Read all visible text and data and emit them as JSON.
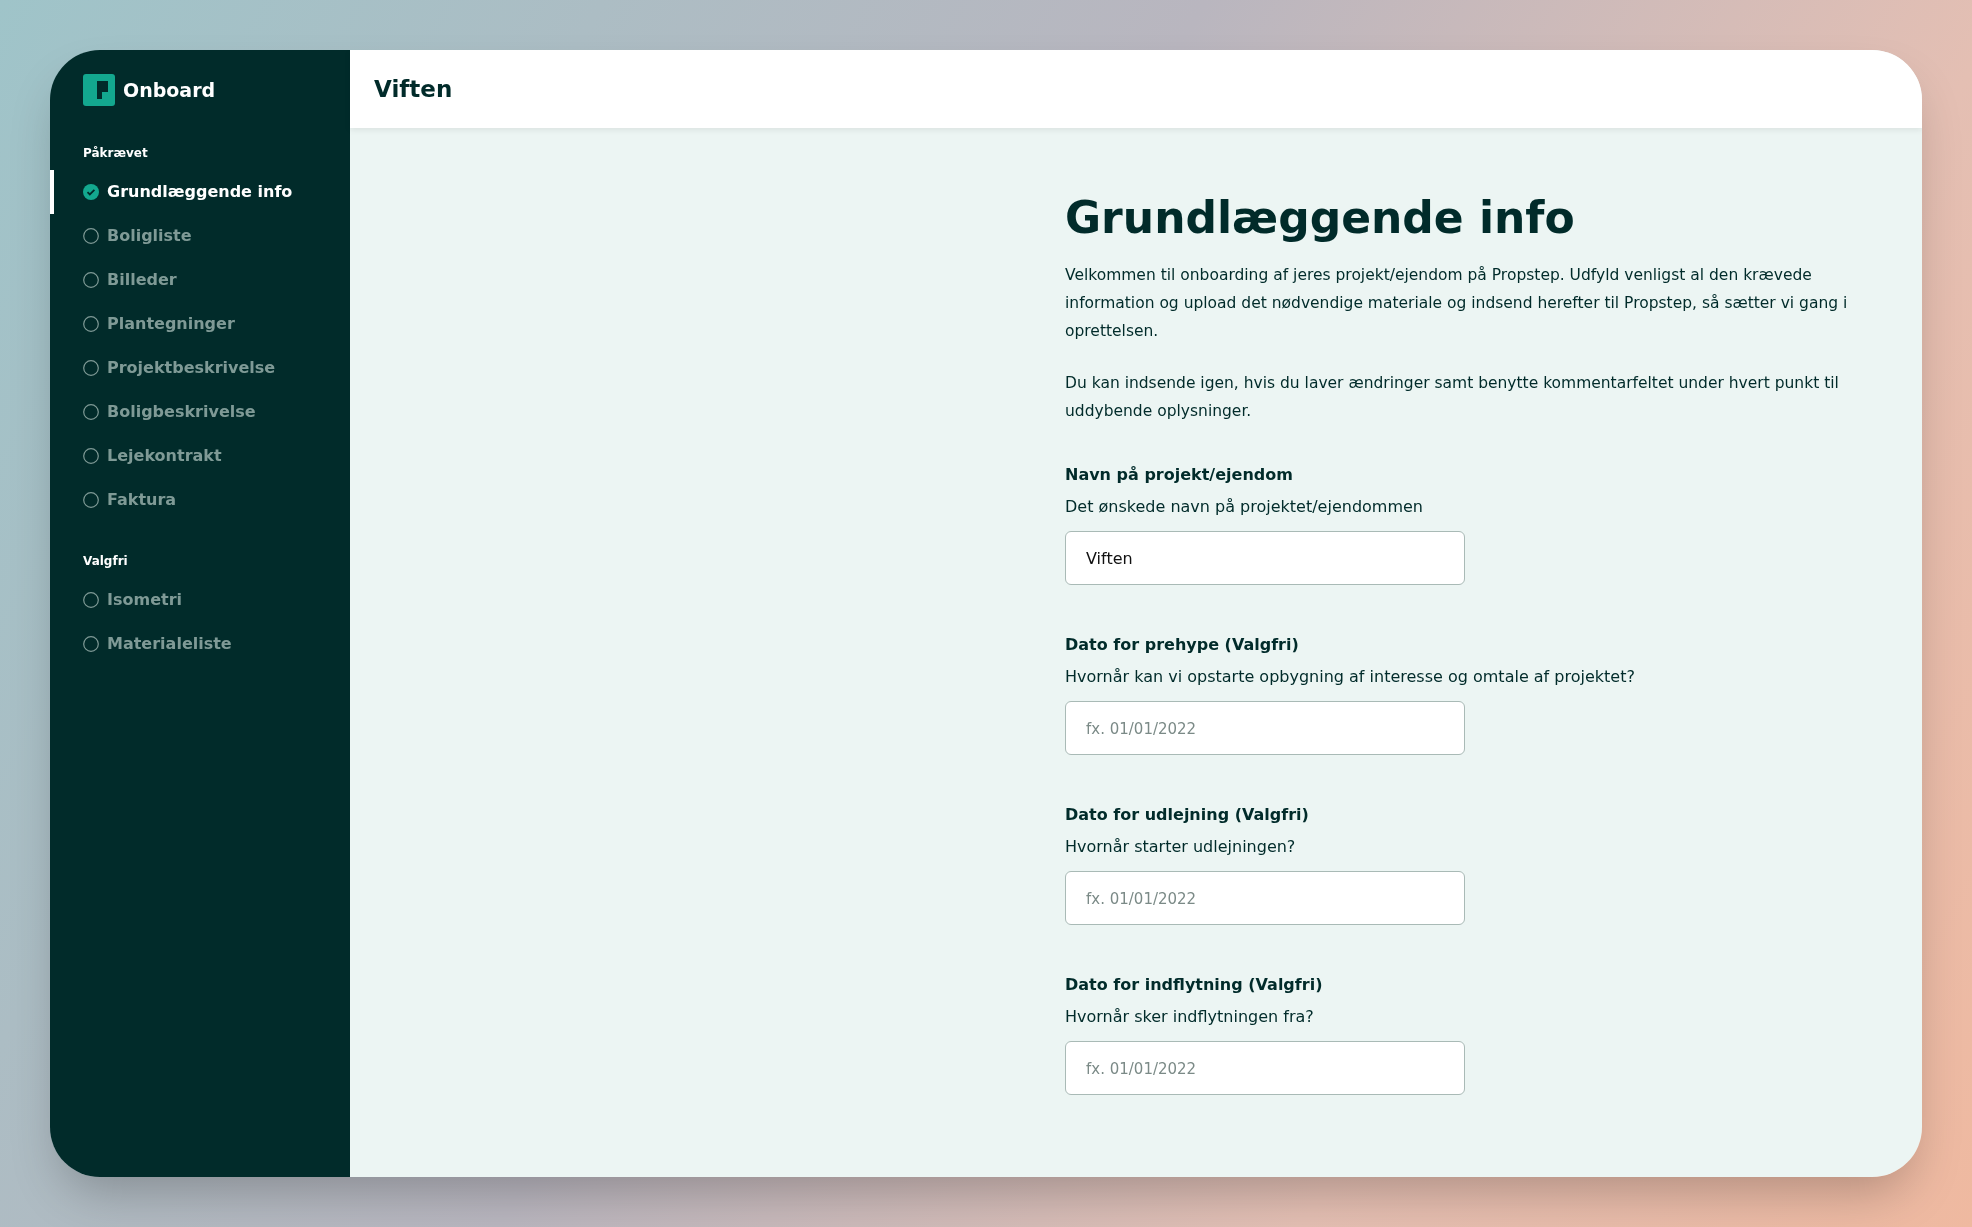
{
  "brand": {
    "name": "Onboard"
  },
  "sidebar": {
    "sections": [
      {
        "heading": "Påkrævet",
        "items": [
          {
            "label": "Grundlæggende info",
            "selected": true,
            "done": true
          },
          {
            "label": "Boligliste",
            "selected": false,
            "done": false
          },
          {
            "label": "Billeder",
            "selected": false,
            "done": false
          },
          {
            "label": "Plantegninger",
            "selected": false,
            "done": false
          },
          {
            "label": "Projektbeskrivelse",
            "selected": false,
            "done": false
          },
          {
            "label": "Boligbeskrivelse",
            "selected": false,
            "done": false
          },
          {
            "label": "Lejekontrakt",
            "selected": false,
            "done": false
          },
          {
            "label": "Faktura",
            "selected": false,
            "done": false
          }
        ]
      },
      {
        "heading": "Valgfri",
        "items": [
          {
            "label": "Isometri",
            "selected": false,
            "done": false
          },
          {
            "label": "Materialeliste",
            "selected": false,
            "done": false
          }
        ]
      }
    ]
  },
  "header": {
    "title": "Viften"
  },
  "content": {
    "title": "Grundlæggende info",
    "paragraphs": [
      "Velkommen til onboarding af jeres projekt/ejendom på Propstep. Udfyld venligst al den krævede information og upload det nødvendige materiale og indsend herefter til Propstep, så sætter vi gang i oprettelsen.",
      "Du kan indsende igen, hvis du laver ændringer samt benytte kommentarfeltet under hvert punkt til uddybende oplysninger."
    ],
    "fields": [
      {
        "label": "Navn på projekt/ejendom",
        "description": "Det ønskede navn på projektet/ejendommen",
        "value": "Viften"
      },
      {
        "label": "Dato for prehype (Valgfri)",
        "description": "Hvornår kan vi opstarte opbygning af interesse og omtale af projektet?",
        "placeholder": "fx. 01/01/2022"
      },
      {
        "label": "Dato for udlejning (Valgfri)",
        "description": "Hvornår starter udlejningen?",
        "placeholder": "fx. 01/01/2022"
      },
      {
        "label": "Dato for indflytning (Valgfri)",
        "description": "Hvornår sker indflytningen fra?",
        "placeholder": "fx. 01/01/2022"
      }
    ]
  }
}
